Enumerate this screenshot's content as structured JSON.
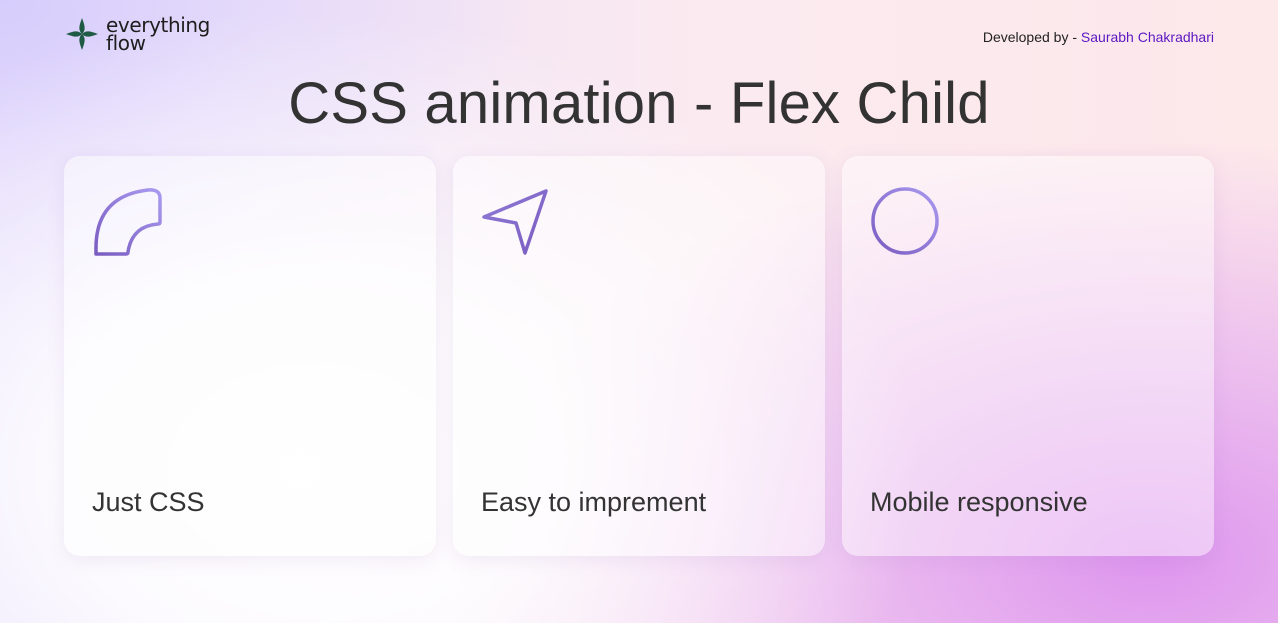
{
  "header": {
    "logo_line1": "everything",
    "logo_line2": "flow",
    "credit_prefix": "Developed by - ",
    "credit_name": "Saurabh Chakradhari"
  },
  "title": "CSS animation - Flex Child",
  "cards": [
    {
      "label": "Just CSS",
      "icon": "quarter-circle-icon"
    },
    {
      "label": "Easy to imprement",
      "icon": "navigation-arrow-icon"
    },
    {
      "label": "Mobile responsive",
      "icon": "circle-icon"
    }
  ],
  "colors": {
    "accent": "#5b18c2",
    "icon_stroke_start": "#7a5cc0",
    "icon_stroke_end": "#a99af0",
    "logo_green": "#1f5a45"
  }
}
